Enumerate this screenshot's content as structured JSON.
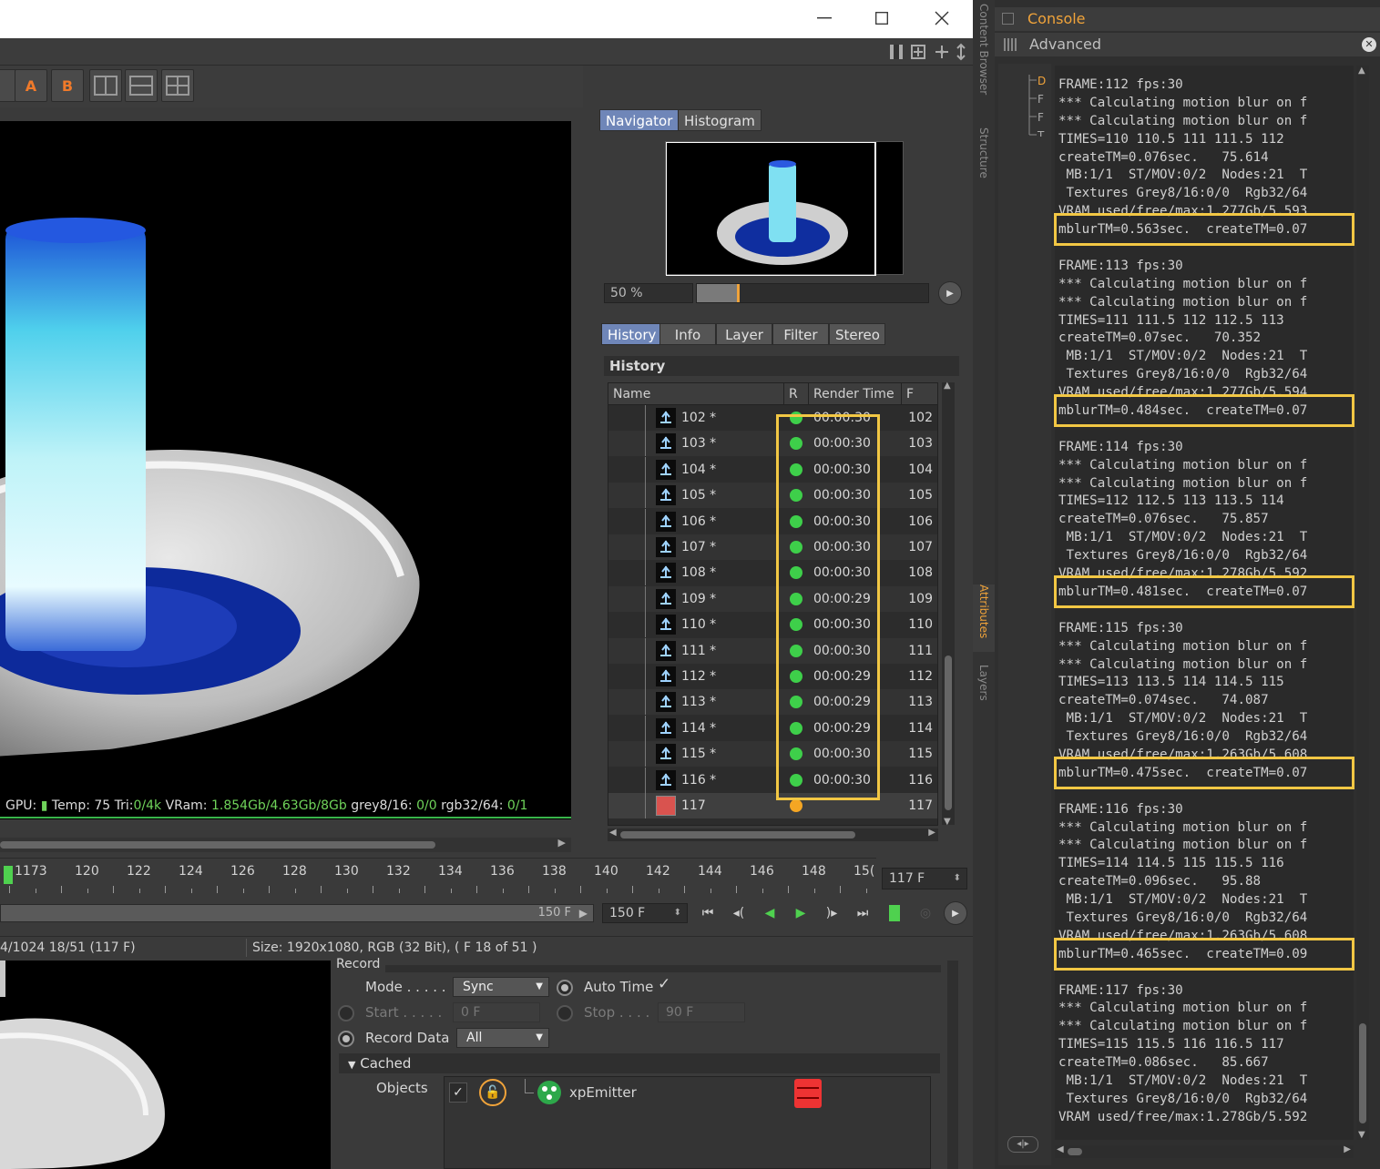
{
  "window": {
    "minimize_glyph": "—",
    "maximize_glyph": "☐",
    "close_glyph": "✕"
  },
  "toolbar": {
    "ab_a_label": "A",
    "ab_b_label": "B"
  },
  "render_status": {
    "gpu": "GPU:",
    "temp_label": "Temp: 75",
    "tri_label": "Tri:",
    "tri_value": "0/4k",
    "vram_label": "VRam:",
    "vram_value": "1.854Gb/4.63Gb/8Gb",
    "grey_label": "grey8/16:",
    "grey_value": "0/0",
    "rgb_label": "rgb32/64:",
    "rgb_value": "0/1"
  },
  "navigator": {
    "tabs": [
      "Navigator",
      "Histogram"
    ],
    "zoom": "50 %"
  },
  "history": {
    "tabs": [
      "History",
      "Info",
      "Layer",
      "Filter",
      "Stereo"
    ],
    "title": "History",
    "columns": [
      "Name",
      "R",
      "Render Time",
      "F"
    ],
    "rows": [
      {
        "name": "102 *",
        "time": "00:00:30",
        "frame": "102"
      },
      {
        "name": "103 *",
        "time": "00:00:30",
        "frame": "103"
      },
      {
        "name": "104 *",
        "time": "00:00:30",
        "frame": "104"
      },
      {
        "name": "105 *",
        "time": "00:00:30",
        "frame": "105"
      },
      {
        "name": "106 *",
        "time": "00:00:30",
        "frame": "106"
      },
      {
        "name": "107 *",
        "time": "00:00:30",
        "frame": "107"
      },
      {
        "name": "108 *",
        "time": "00:00:30",
        "frame": "108"
      },
      {
        "name": "109 *",
        "time": "00:00:29",
        "frame": "109"
      },
      {
        "name": "110 *",
        "time": "00:00:30",
        "frame": "110"
      },
      {
        "name": "111 *",
        "time": "00:00:30",
        "frame": "111"
      },
      {
        "name": "112 *",
        "time": "00:00:29",
        "frame": "112"
      },
      {
        "name": "113 *",
        "time": "00:00:29",
        "frame": "113"
      },
      {
        "name": "114 *",
        "time": "00:00:29",
        "frame": "114"
      },
      {
        "name": "115 *",
        "time": "00:00:30",
        "frame": "115"
      },
      {
        "name": "116 *",
        "time": "00:00:30",
        "frame": "116"
      },
      {
        "name": "117",
        "time": "",
        "frame": "117"
      }
    ],
    "done_color": "#3ecf4a",
    "rendering_color": "#f5a623"
  },
  "timeline": {
    "current_marker": "1173",
    "ticks": [
      "120",
      "122",
      "124",
      "126",
      "128",
      "130",
      "132",
      "134",
      "136",
      "138",
      "140",
      "142",
      "144",
      "146",
      "148",
      "15("
    ],
    "frame_field": "117 F",
    "range_end_label": "150 F",
    "end_field": "150 F"
  },
  "statusbar": {
    "left": "4/1024 18/51 (117 F)",
    "right": "Size: 1920x1080, RGB (32 Bit),  ( F 18 of 51 )"
  },
  "attributes": {
    "record_label": "Record",
    "mode_label": "Mode . . . . .",
    "mode_value": "Sync",
    "auto_time_label": "Auto Time",
    "auto_time_check": "✓",
    "start_label": "Start . . . . .",
    "start_value": "0 F",
    "stop_label": "Stop . . . .",
    "stop_value": "90 F",
    "record_data_label": "Record Data",
    "record_data_value": "All",
    "cached_label": "Cached",
    "objects_label": "Objects",
    "object_name": "xpEmitter"
  },
  "side_tabs": {
    "content_browser": "Content Browser",
    "structure": "Structure",
    "attributes": "Attributes",
    "layers": "Layers"
  },
  "console": {
    "title": "Console",
    "subtitle": "Advanced",
    "lines": [
      "FRAME:112 fps:30",
      "*** Calculating motion blur on f",
      "*** Calculating motion blur on f",
      "TIMES=110 110.5 111 111.5 112",
      "createTM=0.076sec.   75.614",
      " MB:1/1  ST/MOV:0/2  Nodes:21  T",
      " Textures Grey8/16:0/0  Rgb32/64",
      "VRAM used/free/max:1.277Gb/5.593",
      "mblurTM=0.563sec.  createTM=0.07",
      "",
      "FRAME:113 fps:30",
      "*** Calculating motion blur on f",
      "*** Calculating motion blur on f",
      "TIMES=111 111.5 112 112.5 113",
      "createTM=0.07sec.   70.352",
      " MB:1/1  ST/MOV:0/2  Nodes:21  T",
      " Textures Grey8/16:0/0  Rgb32/64",
      "VRAM used/free/max:1.277Gb/5.594",
      "mblurTM=0.484sec.  createTM=0.07",
      "",
      "FRAME:114 fps:30",
      "*** Calculating motion blur on f",
      "*** Calculating motion blur on f",
      "TIMES=112 112.5 113 113.5 114",
      "createTM=0.076sec.   75.857",
      " MB:1/1  ST/MOV:0/2  Nodes:21  T",
      " Textures Grey8/16:0/0  Rgb32/64",
      "VRAM used/free/max:1.278Gb/5.592",
      "mblurTM=0.481sec.  createTM=0.07",
      "",
      "FRAME:115 fps:30",
      "*** Calculating motion blur on f",
      "*** Calculating motion blur on f",
      "TIMES=113 113.5 114 114.5 115",
      "createTM=0.074sec.   74.087",
      " MB:1/1  ST/MOV:0/2  Nodes:21  T",
      " Textures Grey8/16:0/0  Rgb32/64",
      "VRAM used/free/max:1.263Gb/5.608",
      "mblurTM=0.475sec.  createTM=0.07",
      "",
      "FRAME:116 fps:30",
      "*** Calculating motion blur on f",
      "*** Calculating motion blur on f",
      "TIMES=114 114.5 115 115.5 116",
      "createTM=0.096sec.   95.88",
      " MB:1/1  ST/MOV:0/2  Nodes:21  T",
      " Textures Grey8/16:0/0  Rgb32/64",
      "VRAM used/free/max:1.263Gb/5.608",
      "mblurTM=0.465sec.  createTM=0.09",
      "",
      "FRAME:117 fps:30",
      "*** Calculating motion blur on f",
      "*** Calculating motion blur on f",
      "TIMES=115 115.5 116 116.5 117",
      "createTM=0.086sec.   85.667",
      " MB:1/1  ST/MOV:0/2  Nodes:21  T",
      " Textures Grey8/16:0/0  Rgb32/64",
      "VRAM used/free/max:1.278Gb/5.592"
    ]
  }
}
